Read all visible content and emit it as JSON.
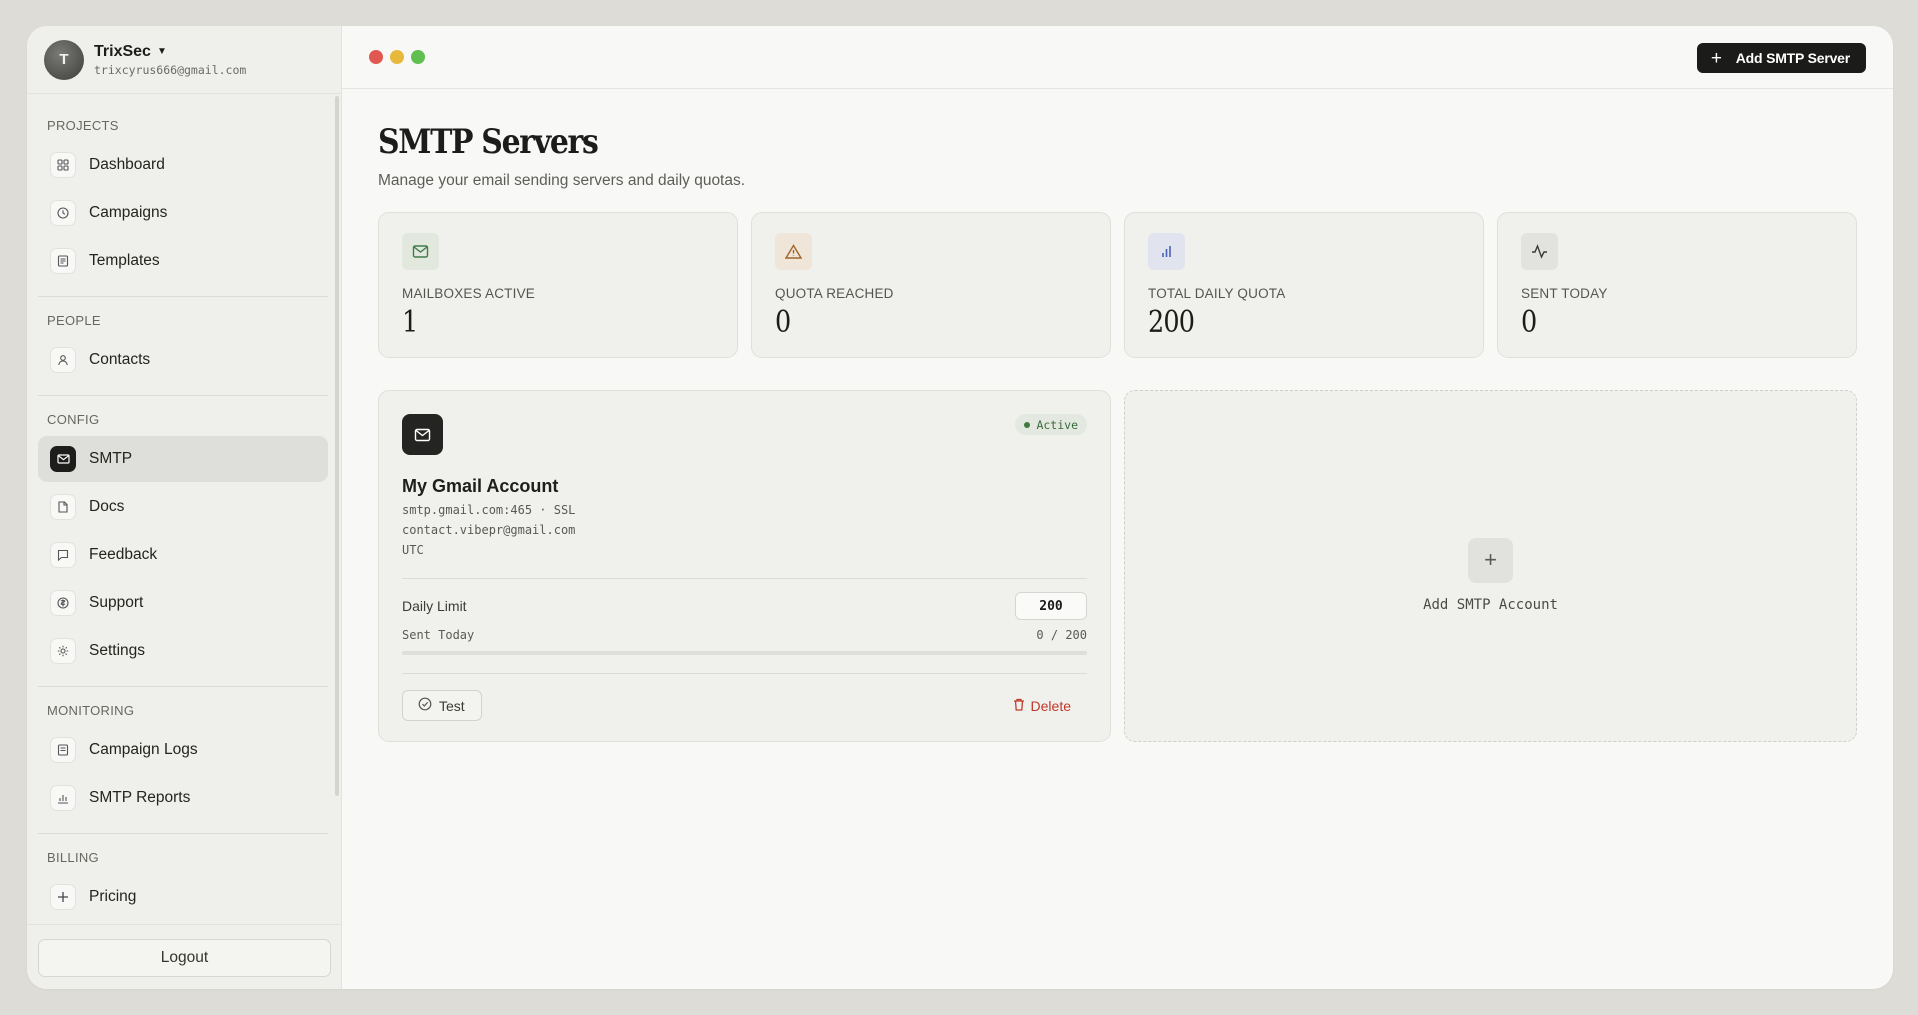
{
  "user": {
    "initial": "T",
    "name": "TrixSec",
    "email": "trixcyrus666@gmail.com"
  },
  "sidebar": {
    "sections": [
      {
        "title": "PROJECTS",
        "items": [
          {
            "label": "Dashboard",
            "icon": "grid-icon"
          },
          {
            "label": "Campaigns",
            "icon": "clock-icon"
          },
          {
            "label": "Templates",
            "icon": "document-icon"
          }
        ]
      },
      {
        "title": "PEOPLE",
        "items": [
          {
            "label": "Contacts",
            "icon": "user-icon"
          }
        ]
      },
      {
        "title": "CONFIG",
        "items": [
          {
            "label": "SMTP",
            "icon": "mail-icon",
            "active": true
          },
          {
            "label": "Docs",
            "icon": "file-icon"
          },
          {
            "label": "Feedback",
            "icon": "chat-icon"
          },
          {
            "label": "Support",
            "icon": "support-icon"
          },
          {
            "label": "Settings",
            "icon": "sun-gear-icon"
          }
        ]
      },
      {
        "title": "MONITORING",
        "items": [
          {
            "label": "Campaign Logs",
            "icon": "log-icon"
          },
          {
            "label": "SMTP Reports",
            "icon": "bar-chart-icon"
          }
        ]
      },
      {
        "title": "BILLING",
        "items": [
          {
            "label": "Pricing",
            "icon": "plus-icon"
          }
        ]
      }
    ],
    "logout_label": "Logout"
  },
  "topbar": {
    "add_server_label": "Add SMTP Server"
  },
  "page": {
    "title": "SMTP Servers",
    "subtitle": "Manage your email sending servers and daily quotas."
  },
  "stats": [
    {
      "label": "MAILBOXES ACTIVE",
      "value": "1",
      "icon": "mail-icon",
      "color": "#3f7a4a",
      "bg": "#e2e8de"
    },
    {
      "label": "QUOTA REACHED",
      "value": "0",
      "icon": "warning-icon",
      "color": "#a0662a",
      "bg": "#efe5d8"
    },
    {
      "label": "TOTAL DAILY QUOTA",
      "value": "200",
      "icon": "bar-chart-icon",
      "color": "#4a63b8",
      "bg": "#e1e4ee"
    },
    {
      "label": "SENT TODAY",
      "value": "0",
      "icon": "activity-icon",
      "color": "#3a3a36",
      "bg": "#e2e2de"
    }
  ],
  "server": {
    "status": "Active",
    "name": "My Gmail Account",
    "host": "smtp.gmail.com:465 · SSL",
    "email": "contact.vibepr@gmail.com",
    "timezone": "UTC",
    "daily_limit_label": "Daily Limit",
    "daily_limit": "200",
    "sent_today_label": "Sent Today",
    "sent_today": "0 / 200",
    "progress": 0,
    "test_label": "Test",
    "delete_label": "Delete"
  },
  "add_account_label": "Add SMTP Account"
}
